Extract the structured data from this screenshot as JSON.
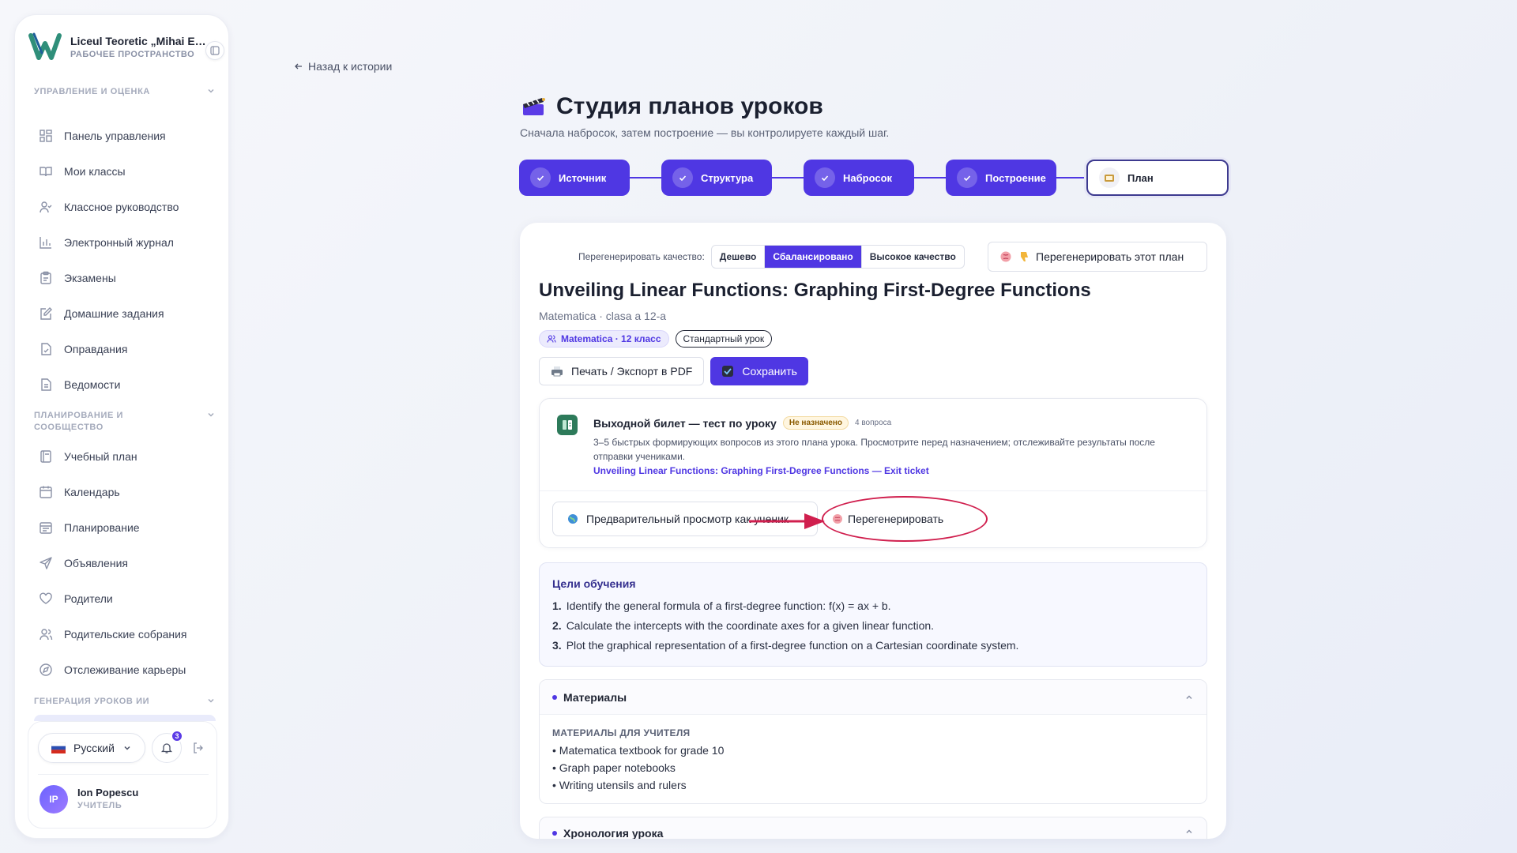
{
  "sidebar": {
    "brand_name": "Liceul Teoretic „Mihai Emi...",
    "brand_sub": "РАБОЧЕЕ ПРОСТРАНСТВО",
    "section1": "УПРАВЛЕНИЕ И ОЦЕНКА",
    "section2": "ПЛАНИРОВАНИЕ И СООБЩЕСТВО",
    "section3": "ГЕНЕРАЦИЯ УРОКОВ ИИ",
    "items": [
      {
        "label": "Панель управления",
        "icon": "dashboard-icon"
      },
      {
        "label": "Мои классы",
        "icon": "book-icon"
      },
      {
        "label": "Классное руководство",
        "icon": "user-check-icon"
      },
      {
        "label": "Электронный журнал",
        "icon": "bar-chart-icon"
      },
      {
        "label": "Экзамены",
        "icon": "clipboard-icon"
      },
      {
        "label": "Домашние задания",
        "icon": "edit-note-icon"
      },
      {
        "label": "Оправдания",
        "icon": "file-check-icon"
      },
      {
        "label": "Ведомости",
        "icon": "file-text-icon"
      },
      {
        "label": "Учебный план",
        "icon": "notebook-icon"
      },
      {
        "label": "Календарь",
        "icon": "calendar-icon"
      },
      {
        "label": "Планирование",
        "icon": "calendar-lines-icon"
      },
      {
        "label": "Объявления",
        "icon": "send-icon"
      },
      {
        "label": "Родители",
        "icon": "heart-icon"
      },
      {
        "label": "Родительские собрания",
        "icon": "users-icon"
      },
      {
        "label": "Отслеживание карьеры",
        "icon": "compass-icon"
      }
    ],
    "language": "Русский",
    "notifications_count": "3",
    "user_initials": "IP",
    "user_name": "Ion Popescu",
    "user_role": "УЧИТЕЛЬ"
  },
  "main": {
    "back_link": "Назад к истории",
    "title": "Студия планов уроков",
    "subtitle": "Сначала набросок, затем построение — вы контролируете каждый шаг.",
    "steps": [
      "Источник",
      "Структура",
      "Набросок",
      "Построение",
      "План"
    ]
  },
  "card": {
    "quality_label": "Перегенерировать качество:",
    "quality_options": [
      "Дешево",
      "Сбалансировано",
      "Высокое качество"
    ],
    "quality_selected": "Сбалансировано",
    "regen_plan": "Перегенерировать этот план",
    "lesson_title": "Unveiling Linear Functions: Graphing First-Degree Functions",
    "lesson_meta": "Matematica · clasa a 12-a",
    "chip_subject": "Matematica · 12 класс",
    "chip_type": "Стандартный урок",
    "print_btn": "Печать / Экспорт в PDF",
    "save_btn": "Сохранить",
    "exit_ticket": {
      "title": "Выходной билет — тест по уроку",
      "status": "Не назначено",
      "questions": "4 вопроса",
      "description": "3–5 быстрых формирующих вопросов из этого плана урока. Просмотрите перед назначением; отслеживайте результаты после отправки учениками.",
      "link": "Unveiling Linear Functions: Graphing First-Degree Functions — Exit ticket",
      "preview_btn": "Предварительный просмотр как ученик",
      "regen_btn": "Перегенерировать"
    },
    "objectives": {
      "title": "Цели обучения",
      "items": [
        {
          "num": "1.",
          "text": "Identify the general formula of a first-degree function: f(x) = ax + b."
        },
        {
          "num": "2.",
          "text": "Calculate the intercepts with the coordinate axes for a given linear function."
        },
        {
          "num": "3.",
          "text": "Plot the graphical representation of a first-degree function on a Cartesian coordinate system."
        }
      ]
    },
    "materials": {
      "title": "Материалы",
      "sub": "МАТЕРИАЛЫ ДЛЯ УЧИТЕЛЯ",
      "items": [
        "• Matematica textbook for grade 10",
        "• Graph paper notebooks",
        "• Writing utensils and rulers"
      ]
    },
    "timeline_title": "Хронология урока"
  },
  "colors": {
    "accent": "#4f37e3",
    "annotation": "#d01f4e"
  }
}
